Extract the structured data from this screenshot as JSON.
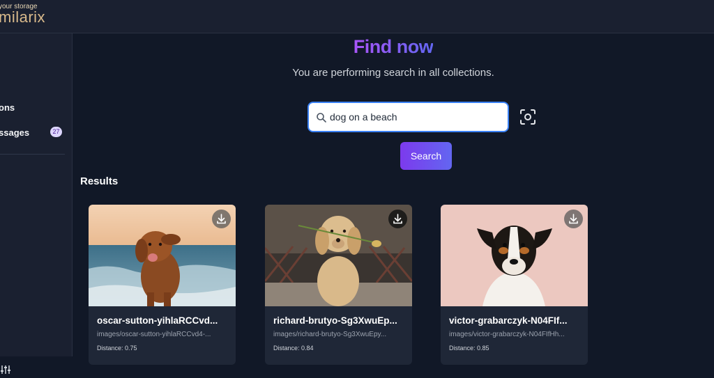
{
  "brand": {
    "tagline": "your storage",
    "name": "milarix",
    "color": "#d8b98b"
  },
  "sidebar": {
    "items": [
      {
        "label": "ons"
      },
      {
        "label": "ssages",
        "badge": "27"
      }
    ],
    "settings_icon": "sliders-icon"
  },
  "main": {
    "heading": "Find now",
    "subtitle": "You are performing search in all collections."
  },
  "search": {
    "value": "dog on a beach",
    "placeholder": "",
    "button_label": "Search",
    "scan_icon": "image-scan-icon"
  },
  "results": {
    "title": "Results",
    "items": [
      {
        "title": "oscar-sutton-yihlaRCCvd...",
        "path": "images/oscar-sutton-yihlaRCCvd4-...",
        "distance": "Distance: 0.75"
      },
      {
        "title": "richard-brutyo-Sg3XwuEp...",
        "path": "images/richard-brutyo-Sg3XwuEpy...",
        "distance": "Distance: 0.84"
      },
      {
        "title": "victor-grabarczyk-N04FIf...",
        "path": "images/victor-grabarczyk-N04FIfHh...",
        "distance": "Distance: 0.85"
      }
    ]
  },
  "colors": {
    "accent": "#7c3aed",
    "background": "#111827",
    "panel": "#1a2030",
    "badge": "#ddd6fe"
  }
}
